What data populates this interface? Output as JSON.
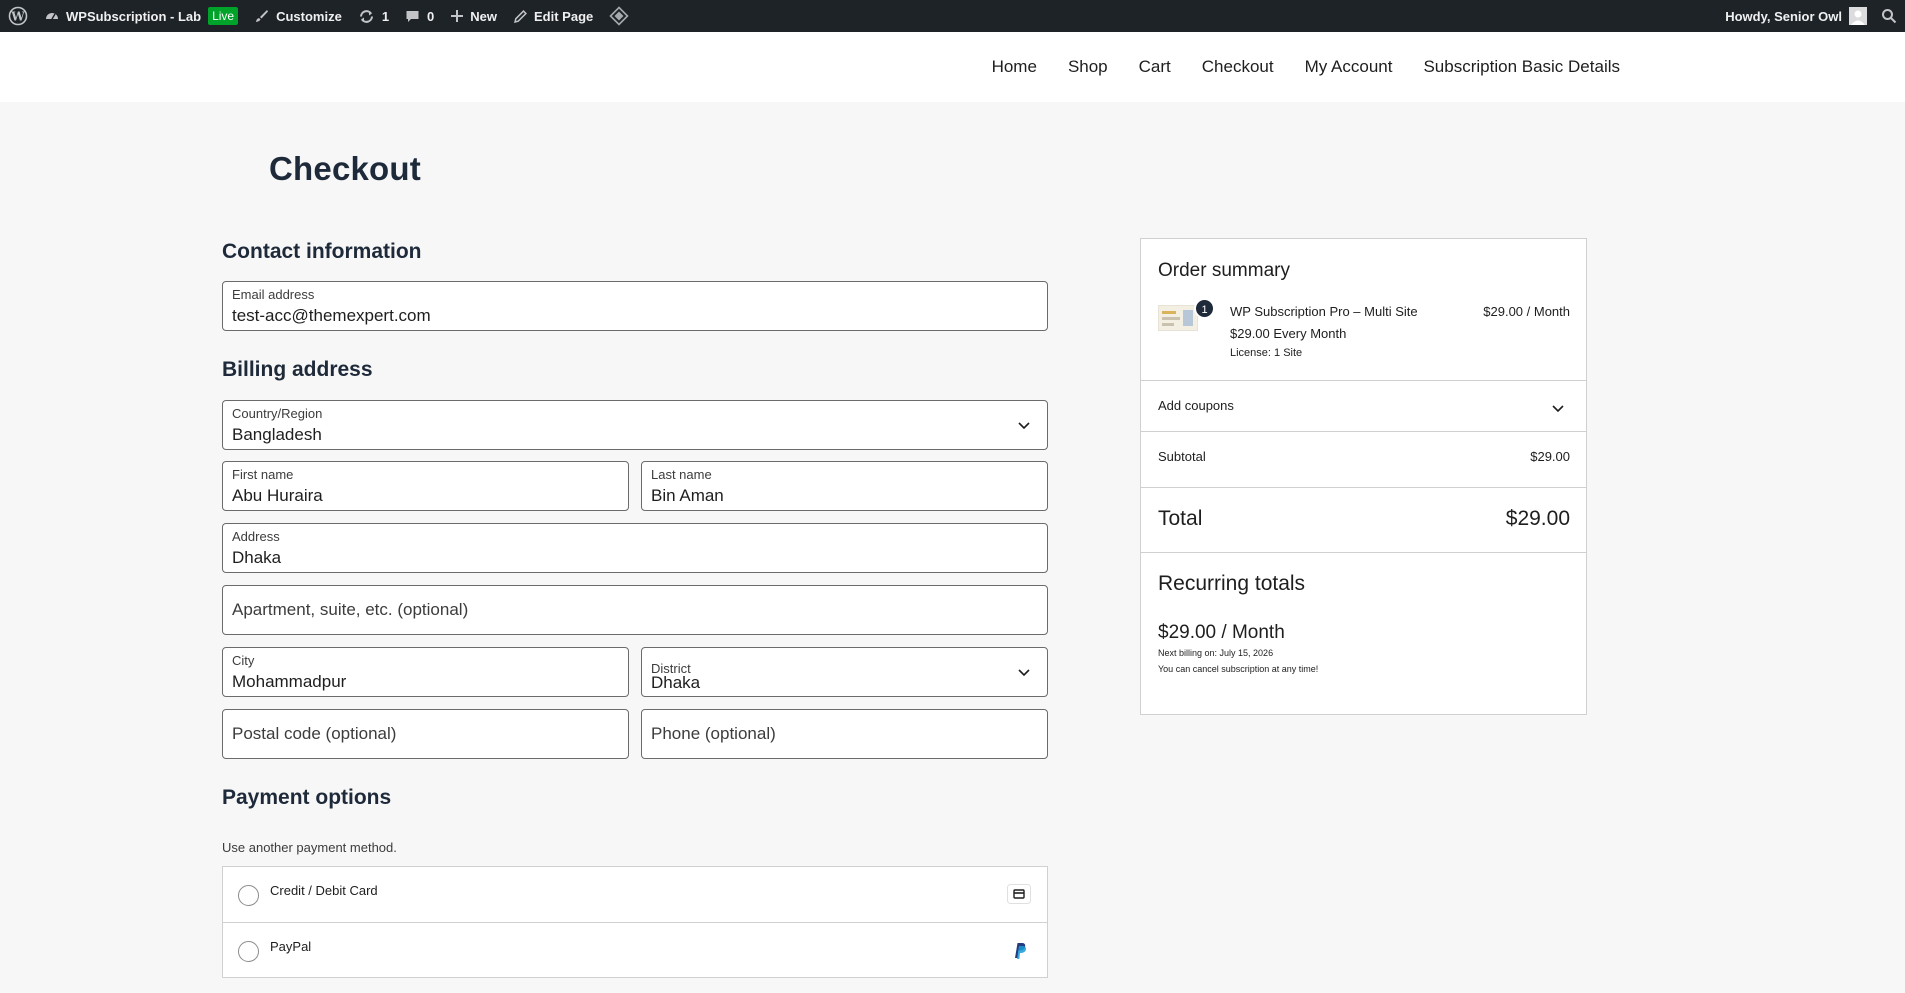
{
  "admin_bar": {
    "site_name": "WPSubscription - Lab",
    "live_badge": "Live",
    "customize": "Customize",
    "updates_count": "1",
    "comments_count": "0",
    "new": "New",
    "edit_page": "Edit Page",
    "greeting": "Howdy, Senior Owl"
  },
  "nav": {
    "items": [
      "Home",
      "Shop",
      "Cart",
      "Checkout",
      "My Account",
      "Subscription Basic Details"
    ]
  },
  "page": {
    "title": "Checkout"
  },
  "contact": {
    "heading": "Contact information",
    "email_label": "Email address",
    "email_value": "test-acc@themexpert.com"
  },
  "billing": {
    "heading": "Billing address",
    "country_label": "Country/Region",
    "country_value": "Bangladesh",
    "first_name_label": "First name",
    "first_name_value": "Abu Huraira",
    "last_name_label": "Last name",
    "last_name_value": "Bin Aman",
    "address_label": "Address",
    "address_value": "Dhaka",
    "apartment_placeholder": "Apartment, suite, etc. (optional)",
    "city_label": "City",
    "city_value": "Mohammadpur",
    "district_label": "District",
    "district_value": "Dhaka",
    "postal_placeholder": "Postal code (optional)",
    "phone_placeholder": "Phone (optional)"
  },
  "payment": {
    "heading": "Payment options",
    "note": "Use another payment method.",
    "options": [
      {
        "label": "Credit / Debit Card",
        "icon": "credit-card-icon"
      },
      {
        "label": "PayPal",
        "icon": "paypal-icon"
      }
    ]
  },
  "summary": {
    "title": "Order summary",
    "item": {
      "quantity": "1",
      "name": "WP Subscription Pro – Multi Site",
      "price": "$29.00 / Month",
      "subtitle": "$29.00 Every Month",
      "license": "License: 1 Site"
    },
    "add_coupons": "Add coupons",
    "subtotal_label": "Subtotal",
    "subtotal_value": "$29.00",
    "total_label": "Total",
    "total_value": "$29.00",
    "recurring_title": "Recurring totals",
    "recurring_price": "$29.00 / Month",
    "next_billing": "Next billing on: July 15, 2026",
    "cancel_note": "You can cancel subscription at any time!"
  },
  "colors": {
    "admin_bar_bg": "#1d2327",
    "live_badge": "#00a32a",
    "heading": "#1e2a3a",
    "page_bg": "#f7f7f7"
  }
}
